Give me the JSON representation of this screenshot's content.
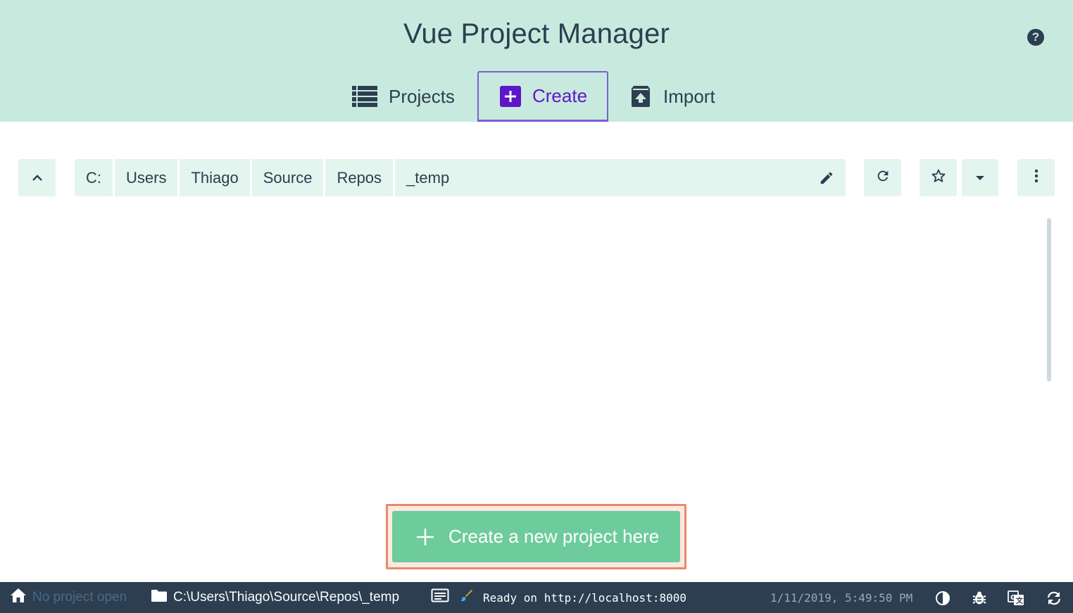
{
  "header": {
    "title": "Vue Project Manager",
    "help_icon": "help-circle-icon"
  },
  "tabs": [
    {
      "label": "Projects",
      "icon": "list-icon",
      "active": false
    },
    {
      "label": "Create",
      "icon": "add-box-icon",
      "active": true
    },
    {
      "label": "Import",
      "icon": "unarchive-icon",
      "active": false
    }
  ],
  "pathbar": {
    "segments": [
      "C:",
      "Users",
      "Thiago",
      "Source",
      "Repos",
      "_temp"
    ],
    "up_icon": "chevron-up-icon",
    "edit_icon": "pencil-icon",
    "refresh_icon": "refresh-icon",
    "star_icon": "star-outline-icon",
    "dropdown_icon": "arrow-drop-down-icon",
    "more_icon": "more-vert-icon"
  },
  "main": {
    "create_button_label": "Create a new project here"
  },
  "statusbar": {
    "project_label": "No project open",
    "cwd": "C:\\Users\\Thiago\\Source\\Repos\\_temp",
    "log_text": "Ready on http://localhost:8000",
    "timestamp": "1/11/2019, 5:49:50 PM"
  },
  "colors": {
    "header_bg": "#c8e9de",
    "accent": "#5d16c9",
    "primary_green": "#6ecb9c",
    "statusbar_bg": "#2c3e50",
    "highlight": "#e8896a"
  }
}
